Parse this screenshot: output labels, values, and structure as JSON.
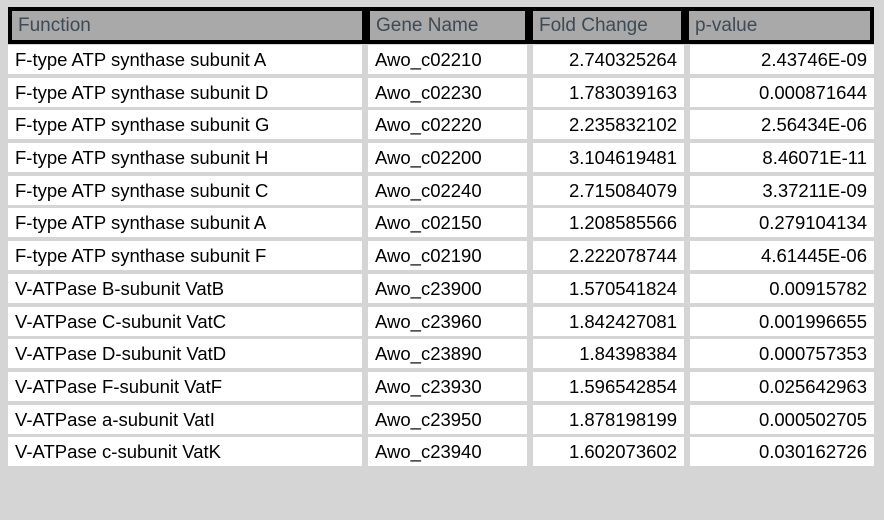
{
  "table": {
    "columns": [
      {
        "key": "function",
        "label": "Function",
        "align": "left"
      },
      {
        "key": "gene_name",
        "label": "Gene Name",
        "align": "left"
      },
      {
        "key": "fold_change",
        "label": "Fold Change",
        "align": "right"
      },
      {
        "key": "p_value",
        "label": "p-value",
        "align": "right"
      }
    ],
    "rows": [
      {
        "function": "F-type ATP synthase subunit A",
        "gene_name": "Awo_c02210",
        "fold_change": "2.740325264",
        "p_value": "2.43746E-09"
      },
      {
        "function": "F-type ATP synthase subunit D",
        "gene_name": "Awo_c02230",
        "fold_change": "1.783039163",
        "p_value": "0.000871644"
      },
      {
        "function": "F-type ATP synthase subunit G",
        "gene_name": "Awo_c02220",
        "fold_change": "2.235832102",
        "p_value": "2.56434E-06"
      },
      {
        "function": "F-type ATP synthase subunit H",
        "gene_name": "Awo_c02200",
        "fold_change": "3.104619481",
        "p_value": "8.46071E-11"
      },
      {
        "function": "F-type ATP synthase subunit C",
        "gene_name": "Awo_c02240",
        "fold_change": "2.715084079",
        "p_value": "3.37211E-09"
      },
      {
        "function": "F-type ATP synthase subunit A",
        "gene_name": "Awo_c02150",
        "fold_change": "1.208585566",
        "p_value": "0.279104134"
      },
      {
        "function": "F-type ATP synthase subunit F",
        "gene_name": "Awo_c02190",
        "fold_change": "2.222078744",
        "p_value": "4.61445E-06"
      },
      {
        "function": "V-ATPase B-subunit VatB",
        "gene_name": "Awo_c23900",
        "fold_change": "1.570541824",
        "p_value": "0.00915782"
      },
      {
        "function": "V-ATPase C-subunit VatC",
        "gene_name": "Awo_c23960",
        "fold_change": "1.842427081",
        "p_value": "0.001996655"
      },
      {
        "function": "V-ATPase D-subunit VatD",
        "gene_name": "Awo_c23890",
        "fold_change": "1.84398384",
        "p_value": "0.000757353"
      },
      {
        "function": "V-ATPase F-subunit VatF",
        "gene_name": "Awo_c23930",
        "fold_change": "1.596542854",
        "p_value": "0.025642963"
      },
      {
        "function": "V-ATPase a-subunit VatI",
        "gene_name": "Awo_c23950",
        "fold_change": "1.878198199",
        "p_value": "0.000502705"
      },
      {
        "function": "V-ATPase c-subunit VatK",
        "gene_name": "Awo_c23940",
        "fold_change": "1.602073602",
        "p_value": "0.030162726"
      }
    ]
  },
  "colors": {
    "page_background": "#d5d5d5",
    "header_background": "#a9a9a9",
    "header_border": "#000000",
    "header_text": "#3e4a55",
    "cell_background": "#ffffff",
    "cell_text": "#000000"
  }
}
